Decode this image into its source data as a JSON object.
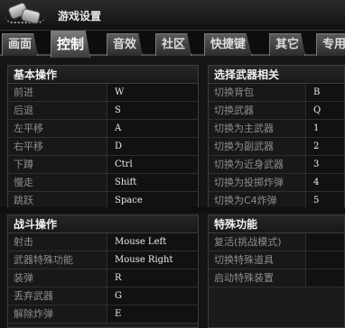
{
  "window": {
    "title": "游戏设置"
  },
  "tabs": [
    {
      "label": "画面"
    },
    {
      "label": "控制"
    },
    {
      "label": "音效"
    },
    {
      "label": "社区"
    },
    {
      "label": "快捷键"
    },
    {
      "label": "其它"
    },
    {
      "label": "专用"
    }
  ],
  "basic": {
    "title": "基本操作",
    "rows": [
      {
        "action": "前进",
        "key": "W"
      },
      {
        "action": "后退",
        "key": "S"
      },
      {
        "action": "左平移",
        "key": "A"
      },
      {
        "action": "右平移",
        "key": "D"
      },
      {
        "action": "下蹲",
        "key": "Ctrl"
      },
      {
        "action": "慢走",
        "key": "Shift"
      },
      {
        "action": "跳跃",
        "key": "Space"
      }
    ]
  },
  "weapons": {
    "title": "选择武器相关",
    "rows": [
      {
        "action": "切换背包",
        "key": "B"
      },
      {
        "action": "切换武器",
        "key": "Q"
      },
      {
        "action": "切换为主武器",
        "key": "1"
      },
      {
        "action": "切换为副武器",
        "key": "2"
      },
      {
        "action": "切换为近身武器",
        "key": "3"
      },
      {
        "action": "切换为投掷炸弹",
        "key": "4"
      },
      {
        "action": "切换为C4炸弹",
        "key": "5"
      }
    ]
  },
  "combat": {
    "title": "战斗操作",
    "rows": [
      {
        "action": "射击",
        "key": "Mouse Left"
      },
      {
        "action": "武器特殊功能",
        "key": "Mouse Right"
      },
      {
        "action": "装弹",
        "key": "R"
      },
      {
        "action": "丢弃武器",
        "key": "G"
      },
      {
        "action": "解除炸弹",
        "key": "E"
      }
    ]
  },
  "special": {
    "title": "特殊功能",
    "rows": [
      {
        "action": "复活(挑战模式)",
        "key": ""
      },
      {
        "action": "切换特殊道具",
        "key": ""
      },
      {
        "action": "启动特殊装置",
        "key": ""
      }
    ]
  }
}
